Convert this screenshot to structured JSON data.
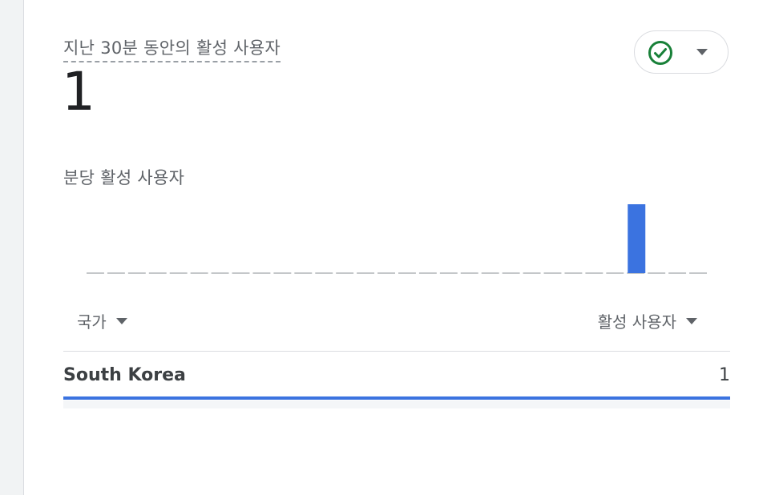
{
  "card": {
    "realtime_title": "지난 30분 동안의 활성 사용자",
    "realtime_value": "1",
    "status_icon": "check-circle-icon",
    "status_color": "#188038",
    "minute_chart_title": "분당 활성 사용자"
  },
  "chart_data": {
    "type": "bar",
    "title": "분당 활성 사용자",
    "series": [
      {
        "values": [
          0,
          0,
          0,
          0,
          0,
          0,
          0,
          0,
          0,
          0,
          0,
          0,
          0,
          0,
          0,
          0,
          0,
          0,
          0,
          0,
          0,
          0,
          0,
          0,
          0,
          0,
          1,
          0,
          0,
          0
        ]
      }
    ],
    "bar_color": "#3b73e0",
    "baseline_color": "#c4c7c9"
  },
  "table": {
    "columns": [
      {
        "label": "국가"
      },
      {
        "label": "활성 사용자"
      }
    ],
    "rows": [
      {
        "country": "South Korea",
        "value": "1",
        "share": 1.0
      }
    ],
    "row_bar_color": "#3b73e0"
  }
}
